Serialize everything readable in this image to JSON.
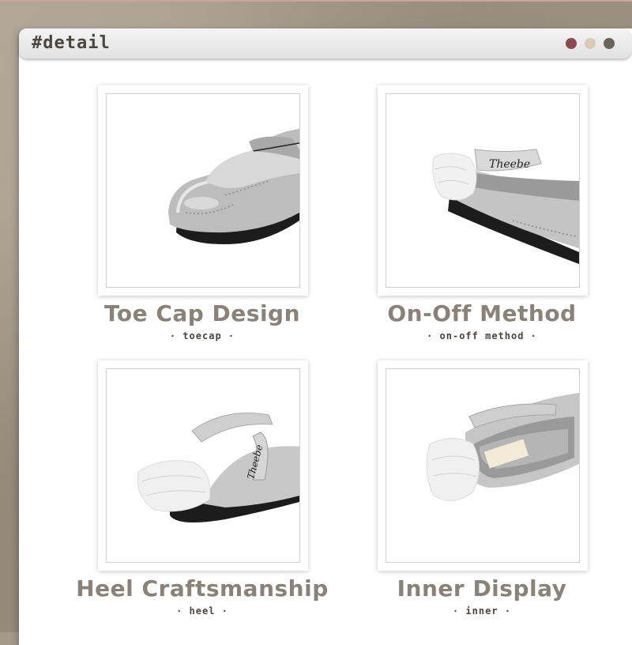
{
  "window": {
    "title": "#detail",
    "dot_colors": [
      "#8b4a4e",
      "#d6ccb8",
      "#6b645c"
    ]
  },
  "details": [
    {
      "title": "Toe Cap Design",
      "subtitle": "· toecap ·",
      "image_icon": "shoe-toecap-photo"
    },
    {
      "title": "On-Off Method",
      "subtitle": "· on-off method ·",
      "image_icon": "shoe-strap-photo"
    },
    {
      "title": "Heel Craftsmanship",
      "subtitle": "· heel ·",
      "image_icon": "shoe-heel-photo"
    },
    {
      "title": "Inner Display",
      "subtitle": "· inner ·",
      "image_icon": "shoe-insole-photo"
    }
  ]
}
